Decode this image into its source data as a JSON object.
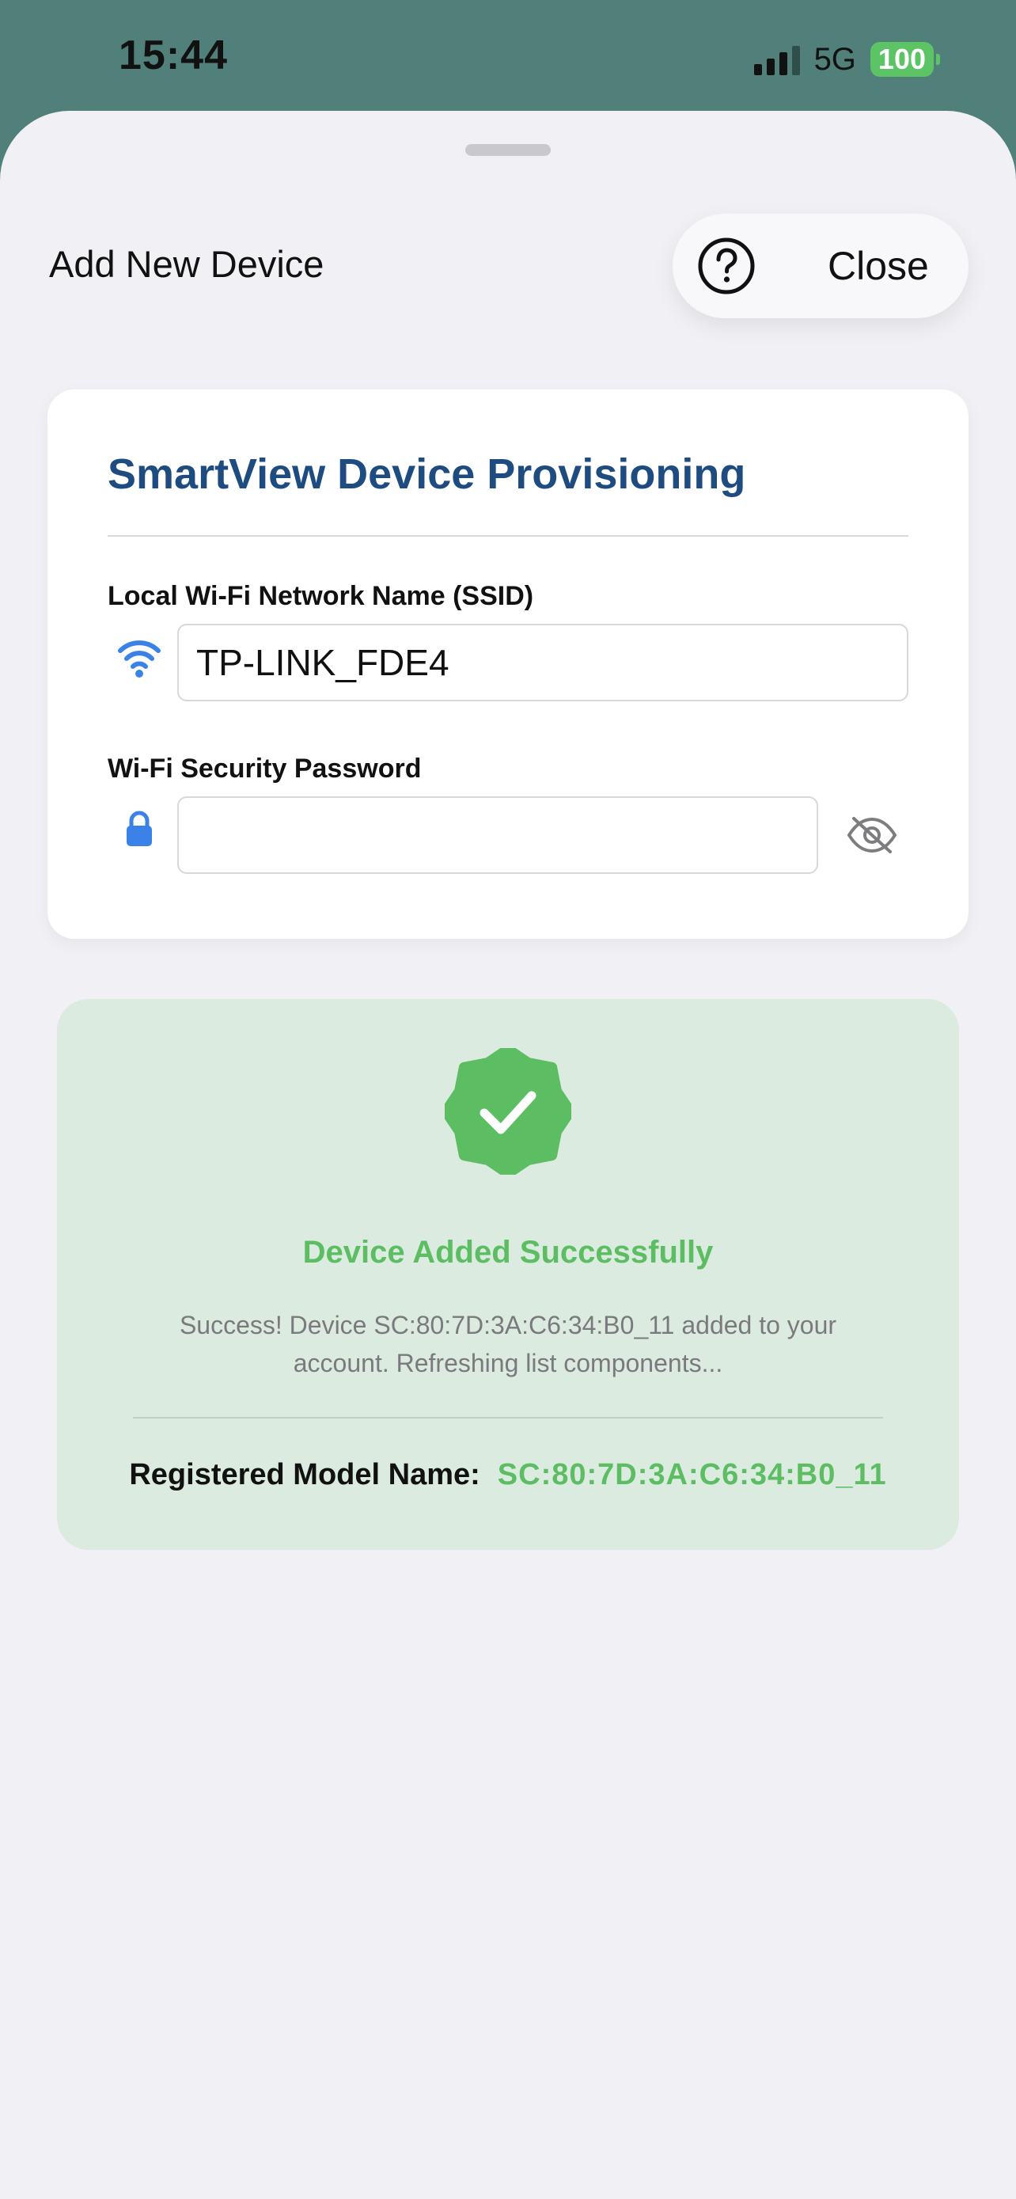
{
  "status_bar": {
    "time": "15:44",
    "network": "5G",
    "battery": "100",
    "icons": [
      "signal-icon",
      "battery-icon"
    ]
  },
  "sheet": {
    "title": "Add New Device",
    "close_label": "Close",
    "help_icon": "question-circle-icon"
  },
  "card": {
    "title": "SmartView Device Provisioning",
    "ssid": {
      "label": "Local Wi-Fi Network Name (SSID)",
      "value": "TP-LINK_FDE4",
      "icon": "wifi-icon"
    },
    "password": {
      "label": "Wi-Fi Security Password",
      "value": "",
      "icon": "lock-icon",
      "toggle_icon": "eye-slash-icon"
    }
  },
  "success": {
    "icon": "check-badge-icon",
    "title": "Device Added Successfully",
    "message": "Success! Device SC:80:7D:3A:C6:34:B0_11 added to your account. Refreshing list components...",
    "model_label": "Registered Model Name:",
    "model_value": "SC:80:7D:3A:C6:34:B0_11"
  },
  "colors": {
    "status_background": "#51807a",
    "sheet_background": "#f1f1f5",
    "card_title": "#1f4c80",
    "accent_blue": "#3b82e8",
    "success_green": "#5cbd62",
    "success_panel": "#dbebe0"
  }
}
